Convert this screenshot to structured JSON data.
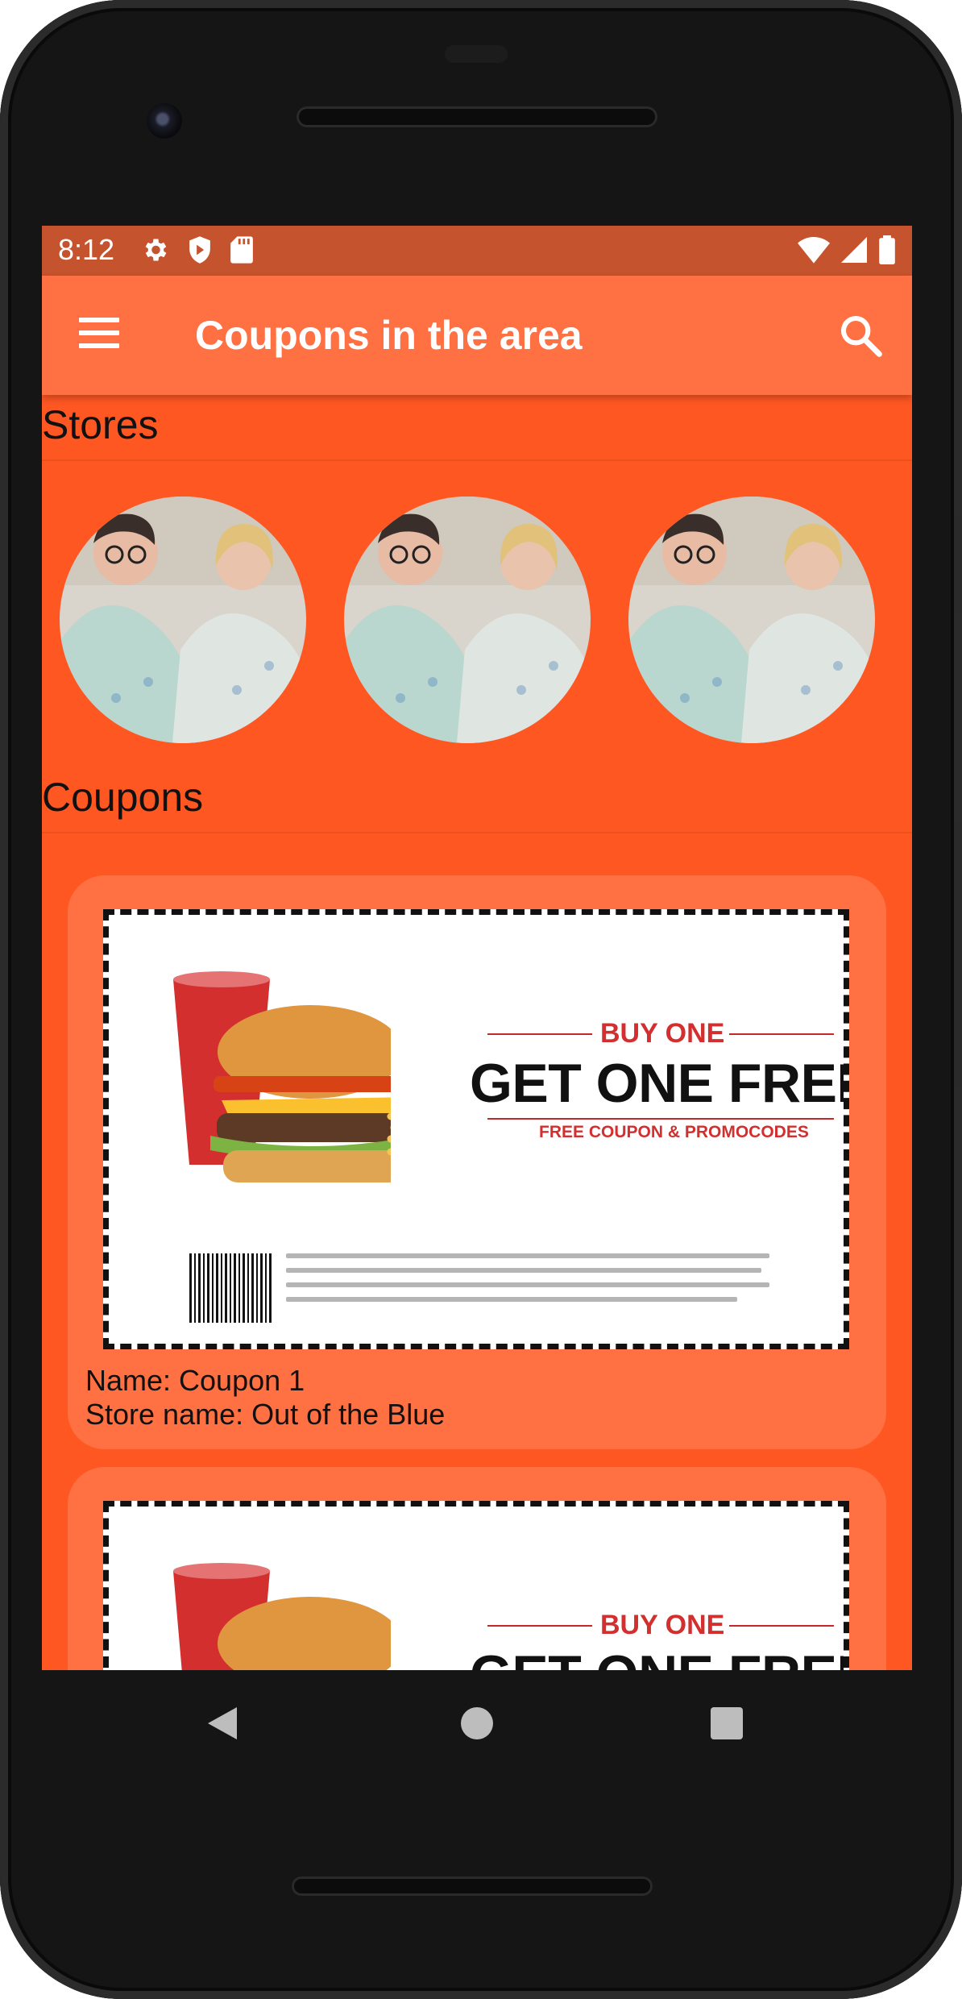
{
  "status_bar": {
    "time": "8:12",
    "left_icons": [
      "gear-icon",
      "shield-icon",
      "sd-card-icon"
    ],
    "right_icons": [
      "wifi-icon",
      "signal-icon",
      "battery-icon"
    ]
  },
  "app_bar": {
    "title": "Coupons in the area",
    "menu_icon": "hamburger-menu-icon",
    "search_icon": "search-icon"
  },
  "stores": {
    "title": "Stores",
    "items": [
      {
        "image": "store-photo"
      },
      {
        "image": "store-photo"
      },
      {
        "image": "store-photo"
      }
    ]
  },
  "coupons": {
    "title": "Coupons",
    "items": [
      {
        "name_line": "Name: Coupon 1",
        "store_line": "Store name: Out of the Blue",
        "image": {
          "buy_one": "BUY ONE",
          "get_one_free": "GET ONE FREE",
          "promo": "FREE COUPON & PROMOCODES"
        }
      },
      {
        "image": {
          "buy_one": "BUY ONE",
          "get_one_free": "GET ONE FREE"
        }
      }
    ]
  },
  "nav_bar": {
    "icons": [
      "back-icon",
      "home-icon",
      "recents-icon"
    ]
  },
  "colors": {
    "primary": "#ff7043",
    "background": "#ff5722",
    "status_bar": "#c4532e"
  }
}
